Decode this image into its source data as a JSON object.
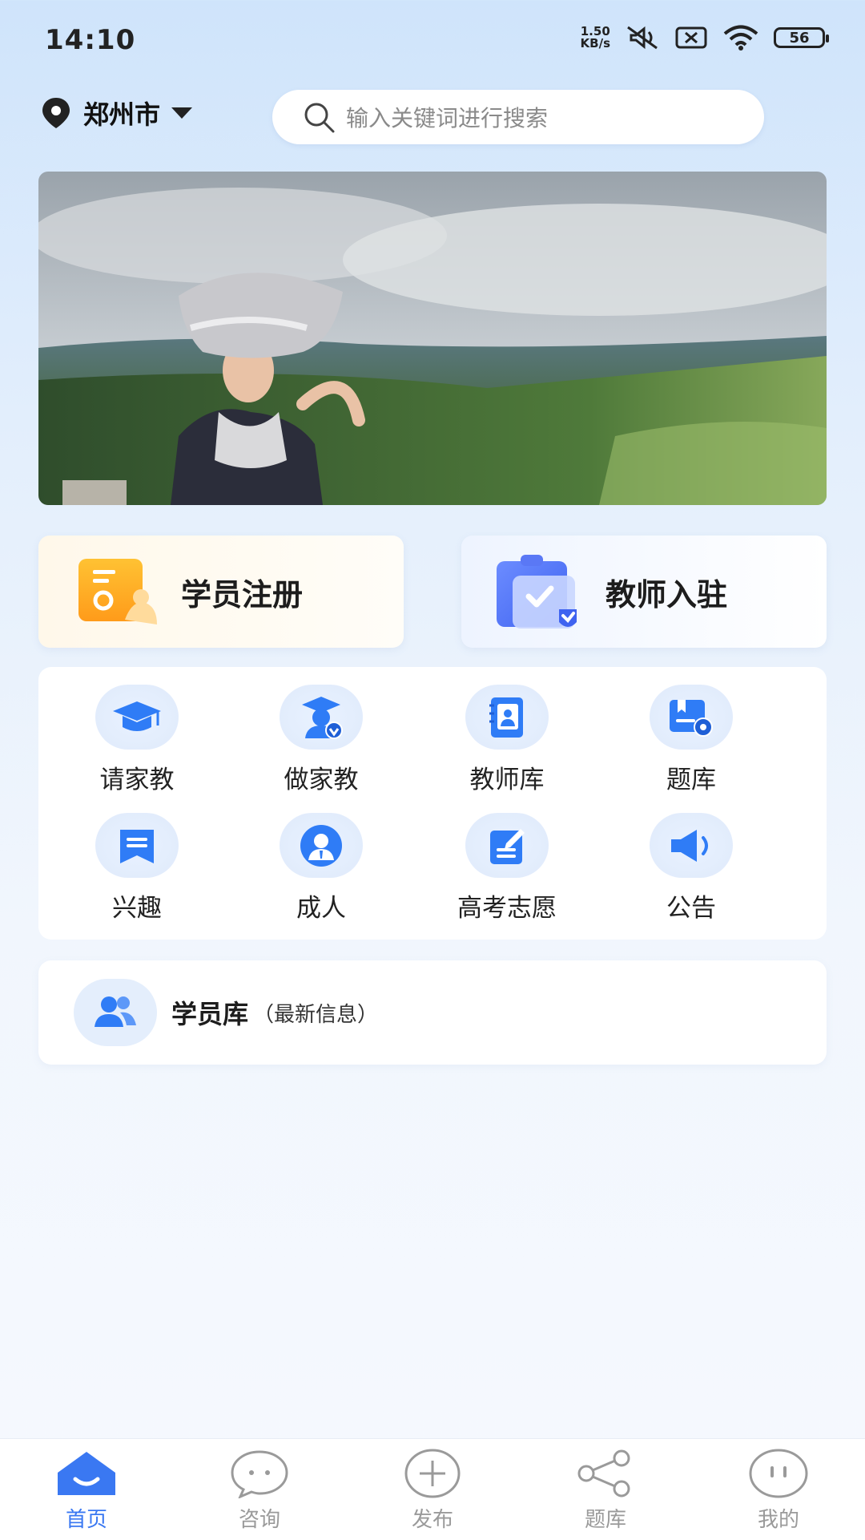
{
  "status_bar": {
    "time": "14:10",
    "net_speed_value": "1.50",
    "net_speed_unit": "KB/s",
    "battery": "56"
  },
  "location": {
    "city": "郑州市"
  },
  "search": {
    "placeholder": "输入关键词进行搜索"
  },
  "quick_cards": {
    "student_register": "学员注册",
    "teacher_join": "教师入驻"
  },
  "grid": {
    "items": [
      {
        "label": "请家教",
        "icon": "graduation-cap-icon"
      },
      {
        "label": "做家教",
        "icon": "teacher-verified-icon"
      },
      {
        "label": "教师库",
        "icon": "teacher-book-icon"
      },
      {
        "label": "题库",
        "icon": "question-bank-icon"
      },
      {
        "label": "兴趣",
        "icon": "interest-bookmark-icon"
      },
      {
        "label": "成人",
        "icon": "adult-person-icon"
      },
      {
        "label": "高考志愿",
        "icon": "exam-form-icon"
      },
      {
        "label": "公告",
        "icon": "megaphone-icon"
      }
    ]
  },
  "student_library": {
    "title": "学员库",
    "subtitle": "（最新信息）"
  },
  "tabbar": {
    "tabs": [
      {
        "label": "首页",
        "icon": "home-icon",
        "active": true
      },
      {
        "label": "咨询",
        "icon": "chat-icon",
        "active": false
      },
      {
        "label": "发布",
        "icon": "plus-circle-icon",
        "active": false
      },
      {
        "label": "题库",
        "icon": "share-icon",
        "active": false
      },
      {
        "label": "我的",
        "icon": "face-icon",
        "active": false
      }
    ]
  },
  "colors": {
    "accent": "#3a78f2",
    "inactive": "#9a9a9a"
  }
}
